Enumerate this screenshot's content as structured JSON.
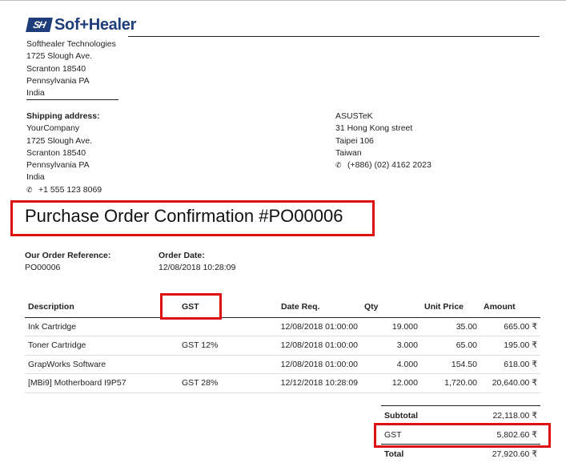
{
  "brand": {
    "mark": "SH",
    "name": "Sof+Healer"
  },
  "company": {
    "lines": [
      "Softhealer Technologies",
      "1725 Slough Ave.",
      "Scranton 18540",
      "Pennsylvania PA",
      "India"
    ]
  },
  "shipping": {
    "label": "Shipping address:",
    "lines": [
      "YourCompany",
      "1725 Slough Ave.",
      "Scranton 18540",
      "Pennsylvania PA",
      "India"
    ],
    "phone": "+1 555 123 8069"
  },
  "vendor": {
    "lines": [
      "ASUSTeK",
      "31 Hong Kong street",
      "Taipei 106",
      "Taiwan"
    ],
    "phone": "(+886) (02) 4162 2023"
  },
  "document": {
    "title": "Purchase Order Confirmation #PO00006"
  },
  "order_ref": {
    "label": "Our Order Reference:",
    "value": "PO00006"
  },
  "order_date": {
    "label": "Order Date:",
    "value": "12/08/2018 10:28:09"
  },
  "table": {
    "headers": [
      "Description",
      "GST",
      "Date Req.",
      "Qty",
      "Unit Price",
      "Amount"
    ],
    "rows": [
      [
        "Ink Cartridge",
        "",
        "12/08/2018 01:00:00",
        "19.000",
        "35.00",
        "665.00 ₹"
      ],
      [
        "Toner Cartridge",
        "GST 12%",
        "12/08/2018 01:00:00",
        "3.000",
        "65.00",
        "195.00 ₹"
      ],
      [
        "GrapWorks Software",
        "",
        "12/08/2018 01:00:00",
        "4.000",
        "154.50",
        "618.00 ₹"
      ],
      [
        "[MBi9] Motherboard I9P57",
        "GST 28%",
        "12/12/2018 10:28:09",
        "12.000",
        "1,720.00",
        "20,640.00 ₹"
      ]
    ]
  },
  "totals": {
    "subtotal_label": "Subtotal",
    "subtotal": "22,118.00 ₹",
    "gst_label": "GST",
    "gst": "5,802.60 ₹",
    "total_label": "Total",
    "total": "27,920.60 ₹"
  },
  "colors": {
    "brand": "#1f3d7a",
    "highlight": "#e01010"
  }
}
